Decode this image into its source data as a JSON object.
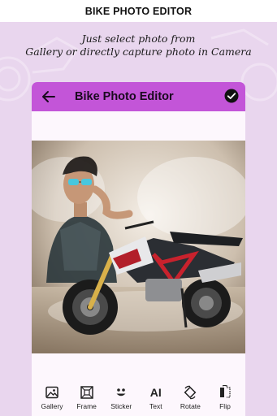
{
  "header": {
    "title": "BIKE PHOTO EDITOR"
  },
  "tagline": {
    "line1": "Just select photo from",
    "line2": "Gallery or directly capture photo in Camera"
  },
  "app": {
    "title": "Bike Photo Editor",
    "accent_color": "#c355d8",
    "icons": {
      "back": "arrow-left-icon",
      "confirm": "check-circle-icon"
    }
  },
  "photo": {
    "description_icon": "edited-photo-image"
  },
  "tools": [
    {
      "label": "Gallery",
      "icon": "image-icon"
    },
    {
      "label": "Frame",
      "icon": "frame-icon"
    },
    {
      "label": "Sticker",
      "icon": "sticker-face-icon"
    },
    {
      "label": "Text",
      "icon": "text-ai-icon",
      "glyph": "AI"
    },
    {
      "label": "Rotate",
      "icon": "rotate-icon"
    },
    {
      "label": "Flip",
      "icon": "flip-icon"
    }
  ]
}
